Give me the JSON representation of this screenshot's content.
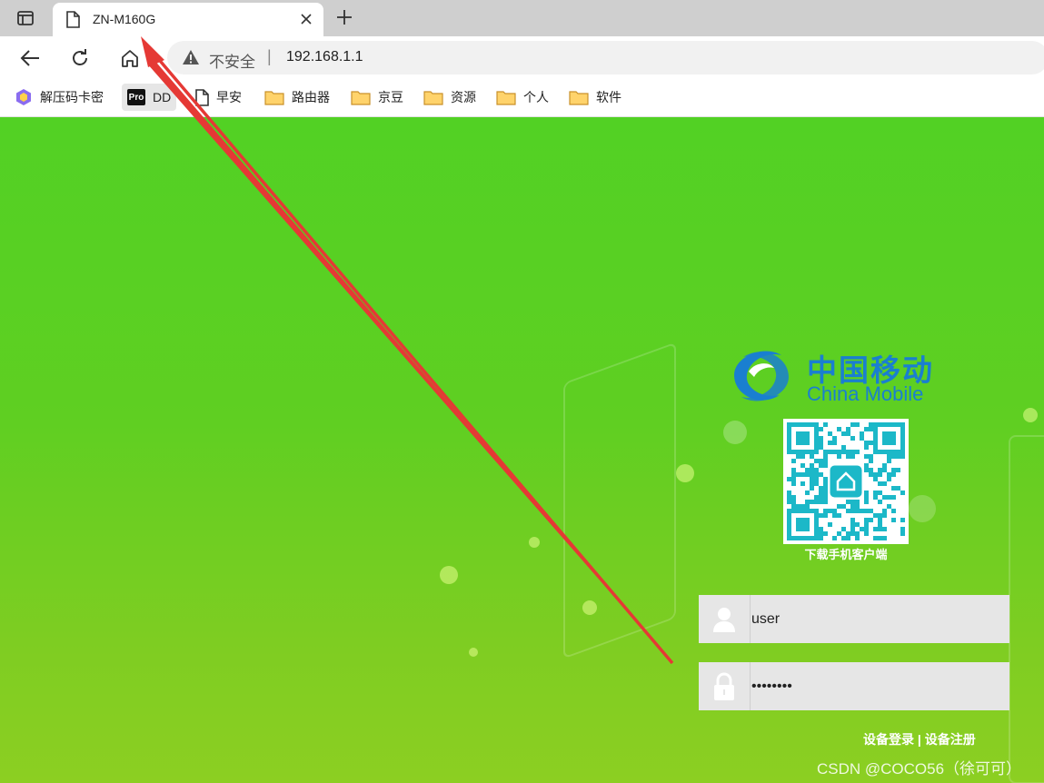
{
  "browser": {
    "tab_title": "ZN-M160G",
    "address": {
      "security_label": "不安全",
      "separator": "|",
      "url": "192.168.1.1"
    },
    "bookmarks": [
      {
        "label": "解压码卡密",
        "icon": "gem-icon"
      },
      {
        "label": "DD",
        "icon": "pro-icon",
        "icon_text": "Pro"
      },
      {
        "label": "早安",
        "icon": "page-icon"
      },
      {
        "label": "路由器",
        "icon": "folder-icon"
      },
      {
        "label": "京豆",
        "icon": "folder-icon"
      },
      {
        "label": "资源",
        "icon": "folder-icon"
      },
      {
        "label": "个人",
        "icon": "folder-icon"
      },
      {
        "label": "软件",
        "icon": "folder-icon"
      }
    ]
  },
  "login": {
    "brand_cn": "中国移动",
    "brand_en": "China Mobile",
    "qr_caption": "下载手机客户端",
    "username_value": "user",
    "password_value": "********",
    "device_login": "设备登录",
    "links_separator": "|",
    "device_register": "设备注册"
  },
  "watermark": "CSDN @COCO56（徐可可）",
  "colors": {
    "page_green": "#52d124",
    "brand_blue": "#1a7fd0",
    "qr_teal": "#1cb8c8",
    "annotation_red": "#e53935"
  }
}
